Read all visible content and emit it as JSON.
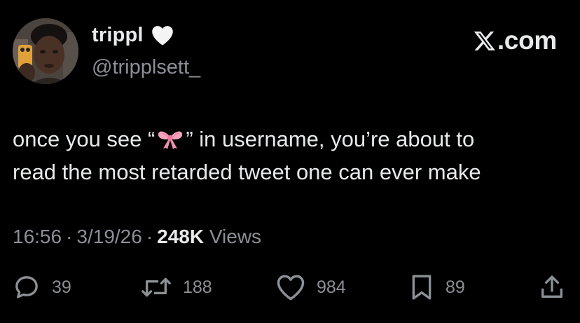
{
  "brand": {
    "suffix": ".com",
    "icon": "x-logo-icon"
  },
  "author": {
    "display_name": "trippl",
    "handle": "@tripplsett_",
    "badge_icon": "white-heart-icon",
    "avatar_icon": "profile-photo"
  },
  "tweet": {
    "line1_before": "once you see “",
    "line1_emoji": "ribbon-bow-icon",
    "line1_after": "” in username, you’re about to",
    "line2": "read the most retarded tweet one can ever make"
  },
  "meta": {
    "time": "16:56",
    "date": "3/19/26",
    "separator": "·",
    "views_count": "248K",
    "views_label": "Views"
  },
  "actions": {
    "reply": {
      "icon": "reply-icon",
      "count": "39"
    },
    "retweet": {
      "icon": "retweet-icon",
      "count": "188"
    },
    "like": {
      "icon": "heart-icon",
      "count": "984"
    },
    "bookmark": {
      "icon": "bookmark-icon",
      "count": "89"
    },
    "share": {
      "icon": "share-icon"
    }
  },
  "colors": {
    "background": "#000000",
    "primary_text": "#e7e9ea",
    "secondary_text": "#8b9096",
    "bow": "#f4a3bd"
  }
}
